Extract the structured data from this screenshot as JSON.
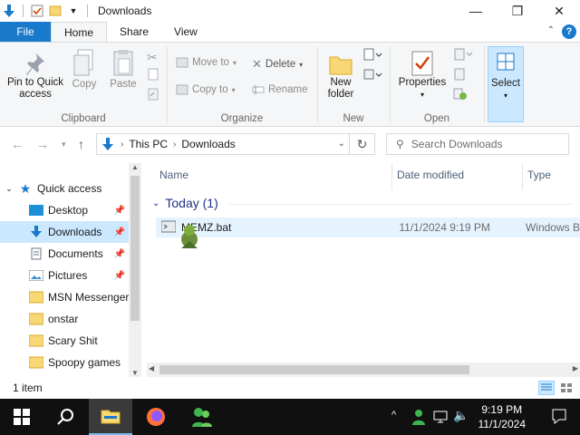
{
  "window": {
    "title": "Downloads",
    "minimize_glyph": "—",
    "maximize_glyph": "❐",
    "close_glyph": "✕"
  },
  "ribbon_tabs": [
    "File",
    "Home",
    "Share",
    "View"
  ],
  "ribbon": {
    "clipboard": {
      "label": "Clipboard",
      "pin_label_1": "Pin to Quick",
      "pin_label_2": "access",
      "copy": "Copy",
      "paste": "Paste"
    },
    "organize": {
      "label": "Organize",
      "move_to": "Move to",
      "copy_to": "Copy to",
      "delete": "Delete",
      "rename": "Rename"
    },
    "new": {
      "label": "New",
      "new_folder_1": "New",
      "new_folder_2": "folder"
    },
    "open": {
      "label": "Open",
      "properties": "Properties"
    },
    "select": {
      "select": "Select"
    }
  },
  "address": {
    "crumbs": [
      "This PC",
      "Downloads"
    ],
    "search_placeholder": "Search Downloads"
  },
  "nav": {
    "quick_access": "Quick access",
    "items": [
      {
        "label": "Desktop",
        "pinned": true
      },
      {
        "label": "Downloads",
        "pinned": true
      },
      {
        "label": "Documents",
        "pinned": true
      },
      {
        "label": "Pictures",
        "pinned": true
      },
      {
        "label": "MSN Messenger",
        "pinned": false
      },
      {
        "label": "onstar",
        "pinned": false
      },
      {
        "label": "Scary Shit",
        "pinned": false
      },
      {
        "label": "Spoopy games",
        "pinned": false
      }
    ]
  },
  "file_list": {
    "columns": {
      "name": "Name",
      "date": "Date modified",
      "type": "Type"
    },
    "group": "Today (1)",
    "files": [
      {
        "name": "MEMZ.bat",
        "date": "11/1/2024 9:19 PM",
        "type": "Windows B"
      }
    ]
  },
  "status": {
    "item_count": "1 item"
  },
  "taskbar": {
    "time": "9:19 PM",
    "date": "11/1/2024"
  },
  "colors": {
    "accent": "#1979ca",
    "selection": "#cce8ff",
    "folder": "#f8d775",
    "taskbar": "#101010"
  }
}
